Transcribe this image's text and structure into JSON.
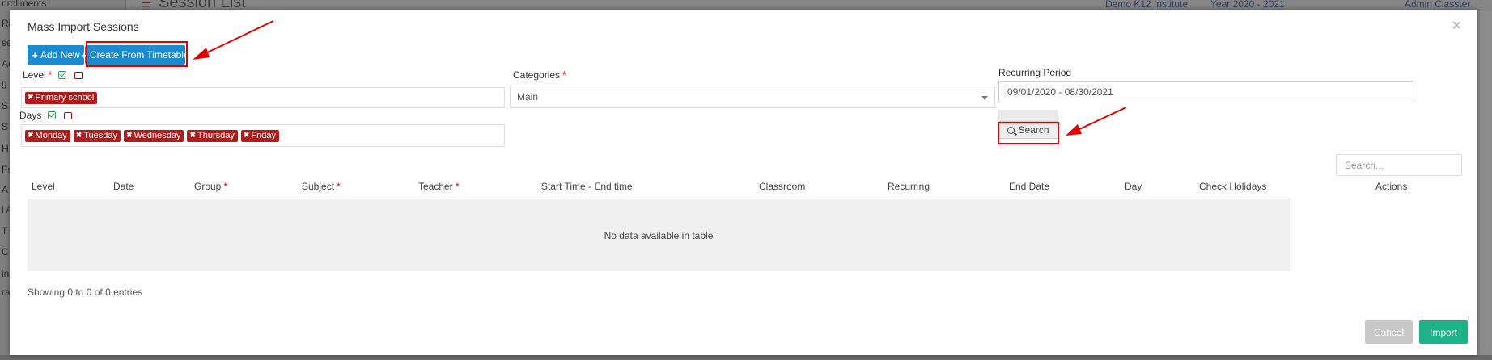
{
  "background": {
    "page_title": "Session List",
    "sidebar_items": [
      "nrollments",
      "Rl",
      "se",
      "Ac",
      "g",
      "S",
      "S",
      "H",
      "Fs",
      "A",
      "l A",
      "T",
      "C",
      "ina",
      "ra"
    ],
    "topbar": {
      "institute": "Demo K12 Institute",
      "year": "Year 2020 - 2021",
      "user": "Admin Classter"
    }
  },
  "modal": {
    "title": "Mass Import Sessions",
    "close_label": "×",
    "add_new_label": "Add New",
    "create_from_timetable_label": "Create From Timetable",
    "level": {
      "label": "Level",
      "required_mark": "*",
      "tags": [
        "Primary school"
      ]
    },
    "days": {
      "label": "Days",
      "tags": [
        "Monday",
        "Tuesday",
        "Wednesday",
        "Thursday",
        "Friday"
      ]
    },
    "categories": {
      "label": "Categories",
      "required_mark": "*",
      "value": "Main"
    },
    "recurring_period": {
      "label": "Recurring Period",
      "value": "09/01/2020 - 08/30/2021"
    },
    "search_button_label": "Search",
    "table": {
      "search_placeholder": "Search...",
      "columns": [
        {
          "label": "Level",
          "required": false
        },
        {
          "label": "Date",
          "required": false
        },
        {
          "label": "Group",
          "required": true
        },
        {
          "label": "Subject",
          "required": true
        },
        {
          "label": "Teacher",
          "required": true
        },
        {
          "label": "Start Time - End time",
          "required": false
        },
        {
          "label": "Classroom",
          "required": false
        },
        {
          "label": "Recurring",
          "required": false
        },
        {
          "label": "End Date",
          "required": false
        },
        {
          "label": "Day",
          "required": false
        },
        {
          "label": "Check Holidays",
          "required": false
        },
        {
          "label": "Actions",
          "required": false
        }
      ],
      "required_mark": "*",
      "empty_message": "No data available in table",
      "showing_text": "Showing 0 to 0 of 0 entries"
    },
    "cancel_label": "Cancel",
    "import_label": "Import"
  },
  "colors": {
    "primary_blue": "#1a8ad1",
    "tag_red": "#b31b1b",
    "import_green": "#1db28a",
    "annotation_red": "#e00000"
  }
}
